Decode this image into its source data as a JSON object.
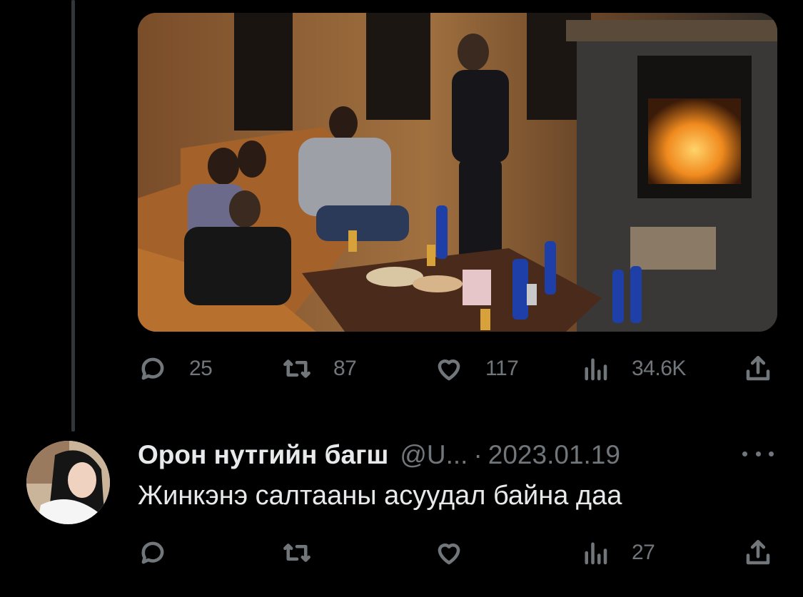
{
  "main_tweet": {
    "media_alt": "",
    "actions": {
      "reply_count": "25",
      "retweet_count": "87",
      "like_count": "117",
      "view_count": "34.6K"
    },
    "icons": {
      "reply": "reply-icon",
      "retweet": "retweet-icon",
      "like": "heart-icon",
      "views": "views-icon",
      "share": "share-icon"
    }
  },
  "reply_tweet": {
    "author_name": "Орон нутгийн багш",
    "handle": "@U...",
    "separator": "·",
    "date": "2023.01.19",
    "text": "Жинкэнэ салтааны асуудал байна даа",
    "actions": {
      "reply_count": "",
      "retweet_count": "",
      "like_count": "",
      "view_count": "27"
    },
    "more_icon": "more-icon"
  },
  "colors": {
    "background": "#000000",
    "text_primary": "#e7e9ea",
    "text_secondary": "#71767b",
    "thread_line": "#333639"
  }
}
